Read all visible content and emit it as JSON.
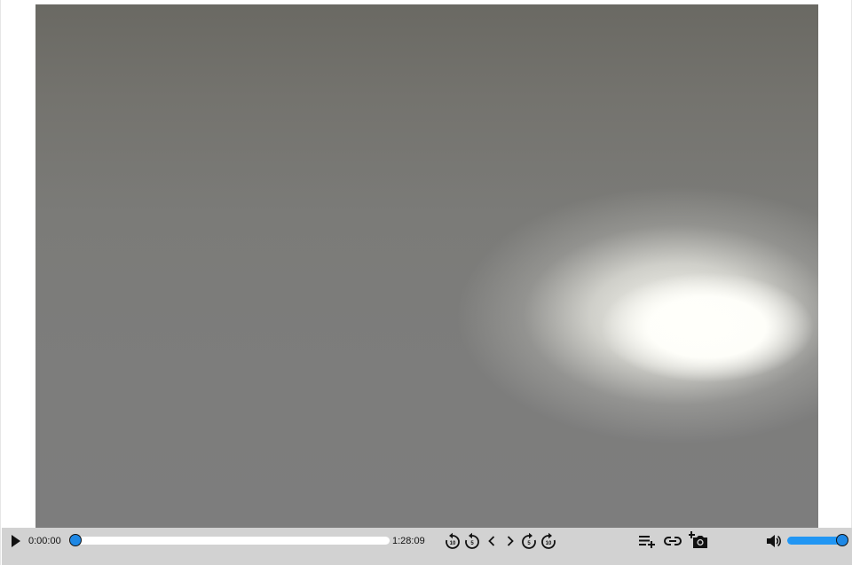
{
  "player": {
    "current_time": "0:00:00",
    "duration": "1:28:09",
    "progress_fraction": 0.0,
    "volume_fraction": 1.0,
    "accent_color": "#2196f3",
    "controls_bg_color": "#d2d2d2"
  },
  "controls": {
    "play": {
      "icon": "play-icon"
    },
    "rewind_10": {
      "icon": "replay-10-icon",
      "label": "10"
    },
    "rewind_5": {
      "icon": "replay-5-icon",
      "label": "5"
    },
    "prev_frame": {
      "icon": "chevron-left-icon"
    },
    "next_frame": {
      "icon": "chevron-right-icon"
    },
    "forward_5": {
      "icon": "forward-5-icon",
      "label": "5"
    },
    "forward_10": {
      "icon": "forward-10-icon",
      "label": "10"
    },
    "add_to_playlist": {
      "icon": "playlist-add-icon"
    },
    "copy_link": {
      "icon": "link-icon"
    },
    "screenshot": {
      "icon": "add-photo-icon"
    },
    "volume": {
      "icon": "volume-up-icon"
    }
  }
}
